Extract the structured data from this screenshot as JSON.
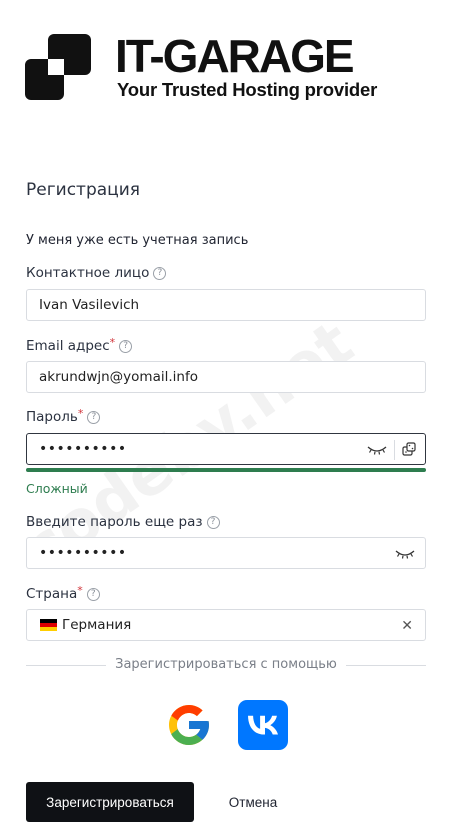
{
  "brand": {
    "name": "IT-GARAGE",
    "tagline": "Your Trusted Hosting provider"
  },
  "watermark": "codeby.net",
  "form": {
    "title": "Регистрация",
    "have_account_link": "У меня уже есть учетная запись",
    "contact": {
      "label": "Контактное лицо",
      "value": "Ivan Vasilevich",
      "help": "?"
    },
    "email": {
      "label": "Email адрес",
      "required_mark": "*",
      "value": "akrundwjn@yomail.info",
      "help": "?"
    },
    "password": {
      "label": "Пароль",
      "required_mark": "*",
      "value": "••••••••••",
      "help": "?",
      "strength_text": "Сложный",
      "strength_color": "#2e7d4f"
    },
    "password_confirm": {
      "label": "Введите пароль еще раз",
      "value": "••••••••••",
      "help": "?"
    },
    "country": {
      "label": "Страна",
      "required_mark": "*",
      "value": "Германия",
      "clear_symbol": "✕",
      "help": "?"
    }
  },
  "social": {
    "divider_text": "Зарегистрироваться с помощью",
    "providers": [
      "google-icon",
      "vk-icon"
    ]
  },
  "actions": {
    "register_label": "Зарегистрироваться",
    "cancel_label": "Отмена"
  },
  "colors": {
    "primary_button": "#0f1115",
    "vk_blue": "#0077ff",
    "required": "#d1343a"
  }
}
